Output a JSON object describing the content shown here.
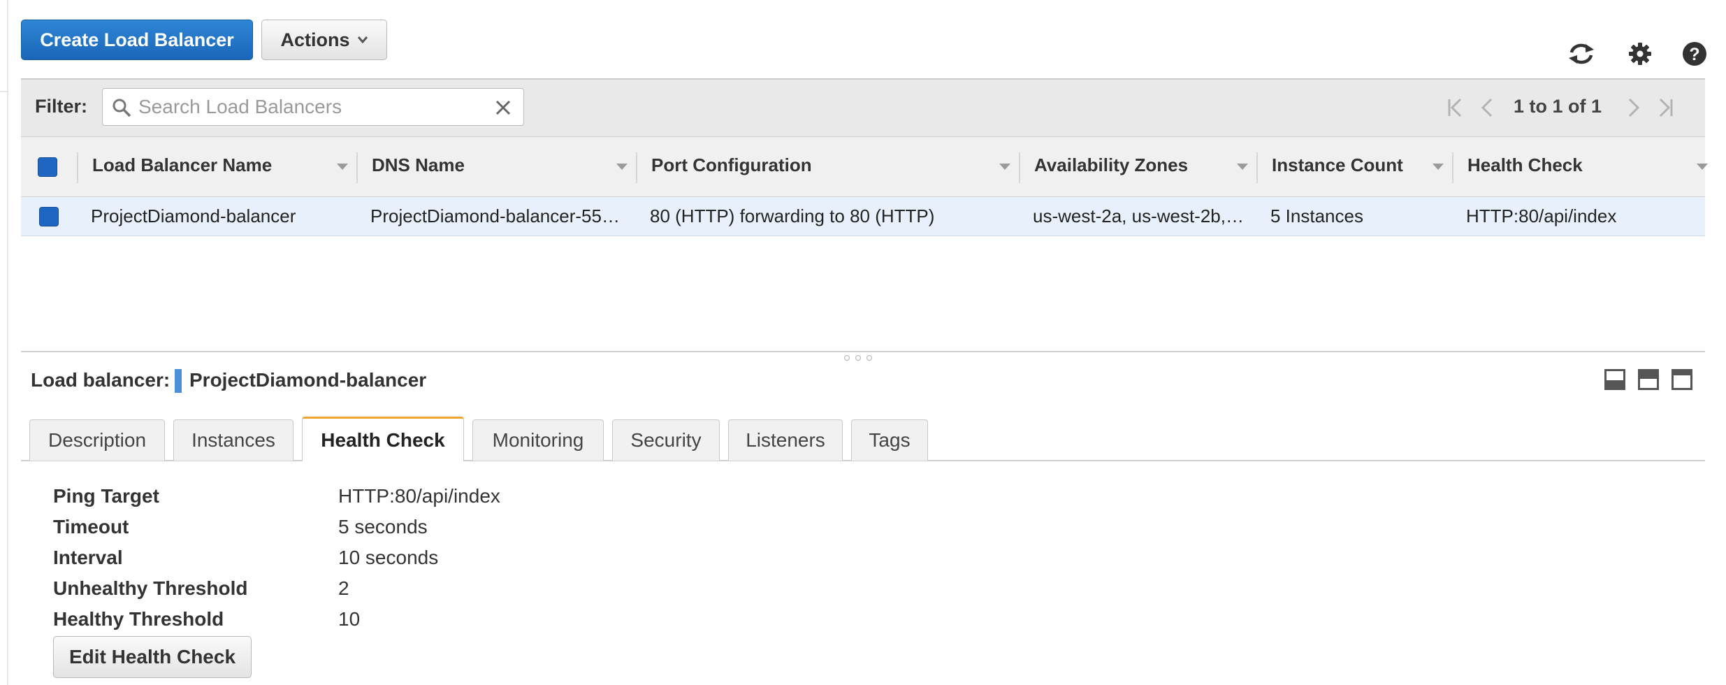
{
  "toolbar": {
    "create_label": "Create Load Balancer",
    "actions_label": "Actions"
  },
  "icons": {
    "refresh": "refresh-icon",
    "settings": "gear-icon",
    "help": "help-icon"
  },
  "filter": {
    "label": "Filter:",
    "placeholder": "Search Load Balancers",
    "value": ""
  },
  "pager": {
    "text": "1 to 1 of 1"
  },
  "table": {
    "columns": [
      "Load Balancer Name",
      "DNS Name",
      "Port Configuration",
      "Availability Zones",
      "Instance Count",
      "Health Check"
    ],
    "rows": [
      {
        "name": "ProjectDiamond-balancer",
        "dns": "ProjectDiamond-balancer-55…",
        "port": "80 (HTTP) forwarding to 80 (HTTP)",
        "zones": "us-west-2a, us-west-2b,…",
        "instances": "5 Instances",
        "health": "HTTP:80/api/index"
      }
    ]
  },
  "detail": {
    "label": "Load balancer:",
    "name": "ProjectDiamond-balancer",
    "tabs": [
      "Description",
      "Instances",
      "Health Check",
      "Monitoring",
      "Security",
      "Listeners",
      "Tags"
    ],
    "active_tab": "Health Check",
    "health_check": [
      {
        "key": "Ping Target",
        "value": "HTTP:80/api/index"
      },
      {
        "key": "Timeout",
        "value": "5 seconds"
      },
      {
        "key": "Interval",
        "value": "10 seconds"
      },
      {
        "key": "Unhealthy Threshold",
        "value": "2"
      },
      {
        "key": "Healthy Threshold",
        "value": "10"
      }
    ],
    "edit_label": "Edit Health Check"
  },
  "colors": {
    "primary": "#1f6fc5",
    "active_tab_accent": "#f0a232",
    "selected_row": "#e8f1fb"
  }
}
